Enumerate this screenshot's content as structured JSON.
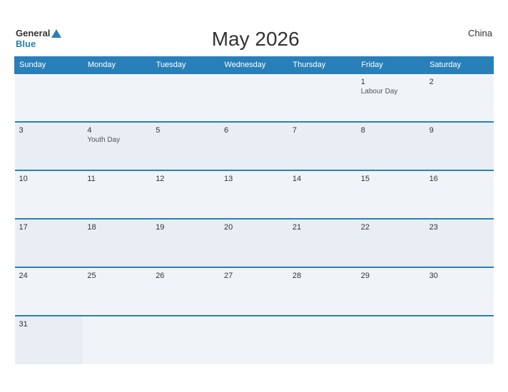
{
  "header": {
    "logo_general": "General",
    "logo_blue": "Blue",
    "title": "May 2026",
    "country": "China"
  },
  "weekdays": [
    "Sunday",
    "Monday",
    "Tuesday",
    "Wednesday",
    "Thursday",
    "Friday",
    "Saturday"
  ],
  "weeks": [
    [
      {
        "day": "",
        "holiday": ""
      },
      {
        "day": "",
        "holiday": ""
      },
      {
        "day": "",
        "holiday": ""
      },
      {
        "day": "",
        "holiday": ""
      },
      {
        "day": "",
        "holiday": ""
      },
      {
        "day": "1",
        "holiday": "Labour Day"
      },
      {
        "day": "2",
        "holiday": ""
      }
    ],
    [
      {
        "day": "3",
        "holiday": ""
      },
      {
        "day": "4",
        "holiday": "Youth Day"
      },
      {
        "day": "5",
        "holiday": ""
      },
      {
        "day": "6",
        "holiday": ""
      },
      {
        "day": "7",
        "holiday": ""
      },
      {
        "day": "8",
        "holiday": ""
      },
      {
        "day": "9",
        "holiday": ""
      }
    ],
    [
      {
        "day": "10",
        "holiday": ""
      },
      {
        "day": "11",
        "holiday": ""
      },
      {
        "day": "12",
        "holiday": ""
      },
      {
        "day": "13",
        "holiday": ""
      },
      {
        "day": "14",
        "holiday": ""
      },
      {
        "day": "15",
        "holiday": ""
      },
      {
        "day": "16",
        "holiday": ""
      }
    ],
    [
      {
        "day": "17",
        "holiday": ""
      },
      {
        "day": "18",
        "holiday": ""
      },
      {
        "day": "19",
        "holiday": ""
      },
      {
        "day": "20",
        "holiday": ""
      },
      {
        "day": "21",
        "holiday": ""
      },
      {
        "day": "22",
        "holiday": ""
      },
      {
        "day": "23",
        "holiday": ""
      }
    ],
    [
      {
        "day": "24",
        "holiday": ""
      },
      {
        "day": "25",
        "holiday": ""
      },
      {
        "day": "26",
        "holiday": ""
      },
      {
        "day": "27",
        "holiday": ""
      },
      {
        "day": "28",
        "holiday": ""
      },
      {
        "day": "29",
        "holiday": ""
      },
      {
        "day": "30",
        "holiday": ""
      }
    ],
    [
      {
        "day": "31",
        "holiday": ""
      },
      {
        "day": "",
        "holiday": ""
      },
      {
        "day": "",
        "holiday": ""
      },
      {
        "day": "",
        "holiday": ""
      },
      {
        "day": "",
        "holiday": ""
      },
      {
        "day": "",
        "holiday": ""
      },
      {
        "day": "",
        "holiday": ""
      }
    ]
  ]
}
